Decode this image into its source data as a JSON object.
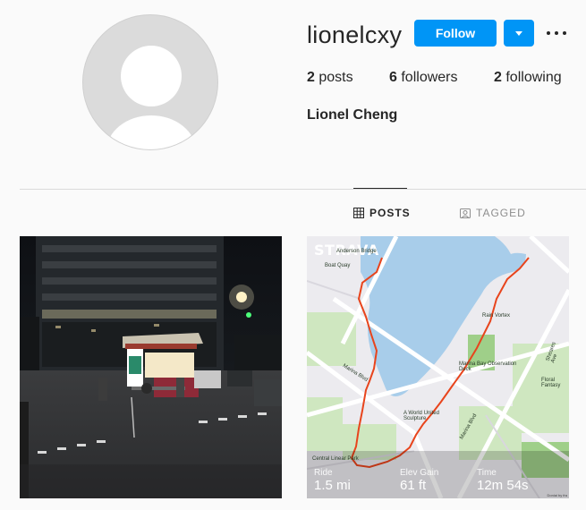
{
  "profile": {
    "username": "lionelcxy",
    "full_name": "Lionel Cheng",
    "follow_label": "Follow"
  },
  "stats": {
    "posts_count": "2",
    "posts_label": "posts",
    "followers_count": "6",
    "followers_label": "followers",
    "following_count": "2",
    "following_label": "following"
  },
  "tabs": [
    {
      "label": "POSTS",
      "icon": "grid-icon",
      "active": true
    },
    {
      "label": "TAGGED",
      "icon": "tagged-icon",
      "active": false
    }
  ],
  "posts": [
    {
      "kind": "photo",
      "subject": "night street food cart"
    },
    {
      "kind": "strava-map",
      "brand": "STRAVA",
      "map_labels": [
        "Anderson Bridge",
        "Boat Quay",
        "Marina Blvd",
        "Rain Vortex",
        "Marina Bay Observation Deck",
        "A World United Sculpture",
        "Marina Blvd",
        "Sheares Ave",
        "Floral Fantasy",
        "Central Linear Park"
      ],
      "ride_label": "Ride",
      "ride_value": "1.5 mi",
      "elev_label": "Elev Gain",
      "elev_value": "61 ft",
      "time_label": "Time",
      "time_value": "12m 54s",
      "powered": "Doniai by fra"
    }
  ],
  "colors": {
    "accent": "#0095f6",
    "text": "#262626",
    "muted": "#8e8e8e",
    "divider": "#dbdbdb",
    "route": "#e8441c",
    "water": "#a8cdea"
  }
}
